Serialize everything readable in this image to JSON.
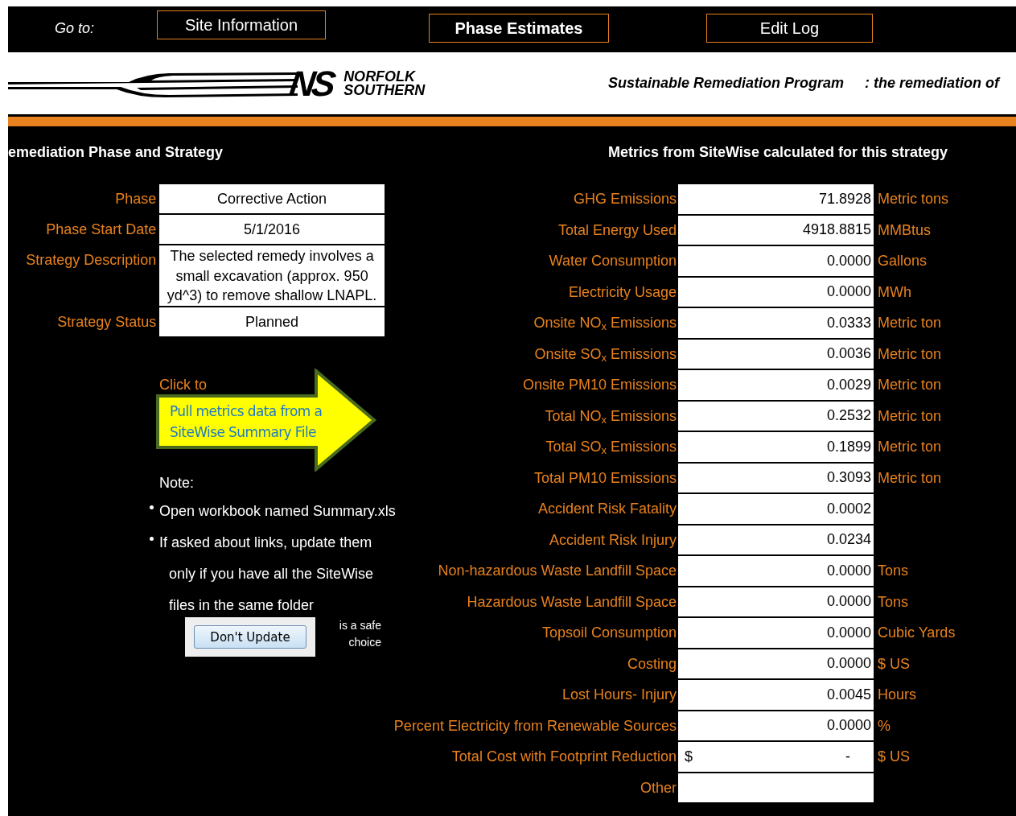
{
  "nav": {
    "label": "Go to:",
    "buttons": [
      {
        "label": "Site Information",
        "selected": false
      },
      {
        "label": "Phase Estimates",
        "selected": true
      },
      {
        "label": "Edit Log",
        "selected": false
      }
    ]
  },
  "banner": {
    "logo_mark": "NS",
    "logo_name": [
      "NORFOLK",
      "SOUTHERN"
    ],
    "program": "Sustainable Remediation Program",
    "tagline": ": the remediation of"
  },
  "phase_section": {
    "heading": "emediation Phase and Strategy",
    "fields": [
      {
        "label": "Phase",
        "value": "Corrective Action",
        "kind": "single"
      },
      {
        "label": "Phase Start Date",
        "value": "5/1/2016",
        "kind": "single"
      },
      {
        "label": "Strategy Description",
        "value": "The selected remedy involves a small excavation (approx. 950 yd^3) to remove shallow LNAPL.",
        "kind": "multi"
      },
      {
        "label": "Strategy Status",
        "value": "Planned",
        "kind": "single"
      }
    ],
    "pull_prompt": "Click to",
    "pull_button": [
      "Pull metrics data from a",
      "SiteWise Summary File"
    ],
    "note_heading": "Note:",
    "notes": [
      {
        "text": "Open workbook named Summary.xls",
        "kind": "bullet"
      },
      {
        "text": "If asked about links, update them",
        "kind": "bullet"
      },
      {
        "text": "only if you have all the SiteWise",
        "kind": "continuation"
      },
      {
        "text": "files in the same folder",
        "kind": "continuation"
      }
    ],
    "dont_update_button": "Don't Update",
    "dont_update_caption": [
      "is a safe",
      "choice"
    ]
  },
  "metrics_section": {
    "heading": "Metrics from SiteWise calculated for this strategy",
    "rows": [
      {
        "label": "GHG Emissions",
        "value": "71.8928",
        "unit": "Metric tons"
      },
      {
        "label": "Total Energy Used",
        "value": "4918.8815",
        "unit": "MMBtus"
      },
      {
        "label": "Water Consumption",
        "value": "0.0000",
        "unit": "Gallons"
      },
      {
        "label": "Electricity Usage",
        "value": "0.0000",
        "unit": "MWh"
      },
      {
        "label": "Onsite NO$_{x}$ Emissions",
        "value": "0.0333",
        "unit": "Metric ton"
      },
      {
        "label": "Onsite SO$_{x}$ Emissions",
        "value": "0.0036",
        "unit": "Metric ton"
      },
      {
        "label": "Onsite PM10 Emissions",
        "value": "0.0029",
        "unit": "Metric ton"
      },
      {
        "label": "Total NO$_{x}$ Emissions",
        "value": "0.2532",
        "unit": "Metric ton"
      },
      {
        "label": "Total SO$_{x}$ Emissions",
        "value": "0.1899",
        "unit": "Metric ton"
      },
      {
        "label": "Total PM10 Emissions",
        "value": "0.3093",
        "unit": "Metric ton"
      },
      {
        "label": "Accident Risk Fatality",
        "value": "0.0002"
      },
      {
        "label": "Accident Risk Injury",
        "value": "0.0234"
      },
      {
        "label": "Non-hazardous Waste Landfill Space",
        "value": "0.0000",
        "unit": "Tons"
      },
      {
        "label": "Hazardous Waste Landfill Space",
        "value": "0.0000",
        "unit": "Tons"
      },
      {
        "label": "Topsoil Consumption",
        "value": "0.0000",
        "unit": "Cubic Yards"
      },
      {
        "label": "Costing",
        "value": "0.0000",
        "unit": "$ US"
      },
      {
        "label": "Lost Hours- Injury",
        "value": "0.0045",
        "unit": "Hours"
      },
      {
        "label": "Percent Electricity from Renewable Sources",
        "value": "0.0000",
        "unit": "%"
      },
      {
        "label": "Total Cost with Footprint Reduction",
        "currency": "$",
        "value": "-",
        "unit": "$ US"
      },
      {
        "label": "Other"
      }
    ]
  }
}
